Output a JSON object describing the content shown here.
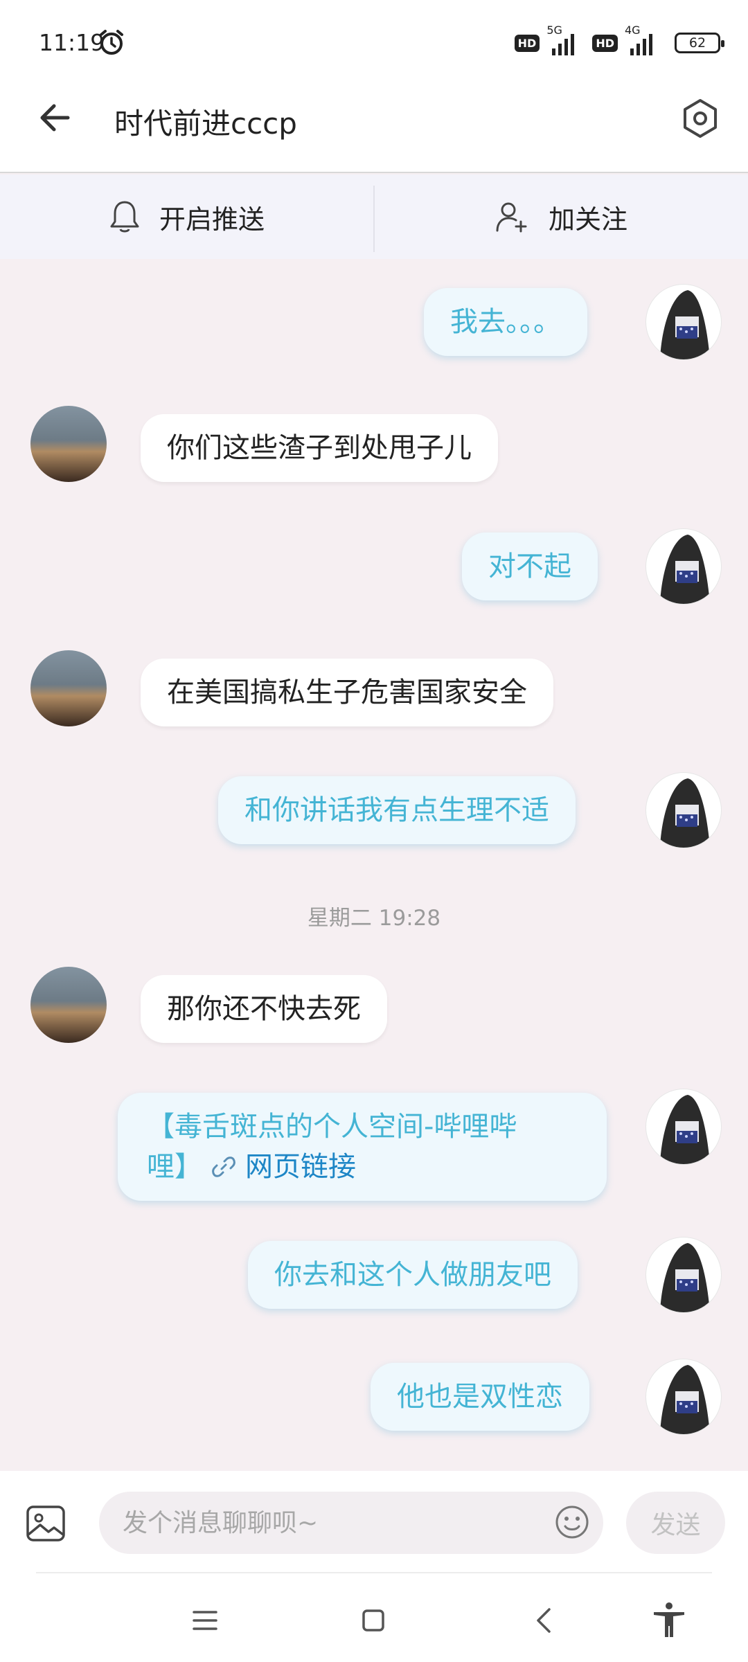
{
  "status": {
    "time": "11:19",
    "network_5g": "5G",
    "network_4g": "4G",
    "hd": "HD",
    "battery": "62"
  },
  "header": {
    "title": "时代前进cccp"
  },
  "actions": {
    "push": "开启推送",
    "follow": "加关注"
  },
  "messages": [
    {
      "side": "self",
      "text": "我去。。。"
    },
    {
      "side": "other",
      "text": "你们这些渣子到处甩子儿"
    },
    {
      "side": "self",
      "text": "对不起"
    },
    {
      "side": "other",
      "text": "在美国搞私生子危害国家安全"
    },
    {
      "side": "self",
      "text": "和你讲话我有点生理不适"
    },
    {
      "side": "other",
      "text": "那你还不快去死"
    },
    {
      "side": "self",
      "line1": "【毒舌斑点的个人空间-哔哩哔",
      "line2": "哩】",
      "link": "网页链接"
    },
    {
      "side": "self",
      "text": "你去和这个人做朋友吧"
    },
    {
      "side": "self",
      "text": "他也是双性恋"
    }
  ],
  "timestamp": "星期二 19:28",
  "input": {
    "placeholder": "发个消息聊聊呗~",
    "send_label": "发送"
  },
  "icons": [
    "alarm-icon",
    "back-arrow-icon",
    "settings-hexagon-icon",
    "bell-icon",
    "add-user-icon",
    "image-icon",
    "emoji-icon",
    "link-icon",
    "menu-icon",
    "home-icon",
    "back-icon",
    "accessibility-icon"
  ]
}
